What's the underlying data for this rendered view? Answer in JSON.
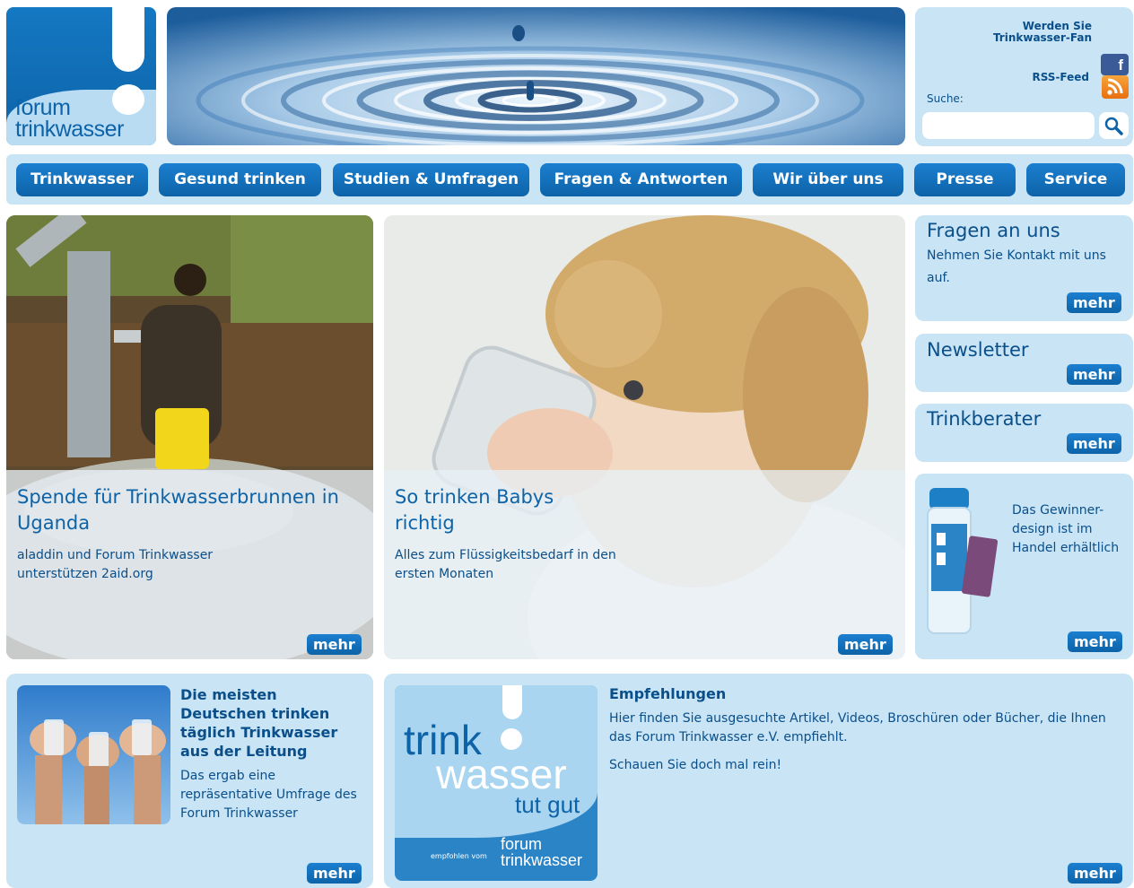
{
  "logo": {
    "line1": "forum",
    "line2": "trinkwasser"
  },
  "topright": {
    "fan_text": "Werden Sie Trinkwasser-Fan",
    "rss_label": "RSS-Feed",
    "search_label": "Suche:",
    "search_value": ""
  },
  "nav": [
    {
      "label": "Trinkwasser"
    },
    {
      "label": "Gesund trinken"
    },
    {
      "label": "Studien & Umfragen"
    },
    {
      "label": "Fragen & Antworten"
    },
    {
      "label": "Wir über uns"
    },
    {
      "label": "Presse"
    },
    {
      "label": "Service"
    }
  ],
  "features": [
    {
      "title": "Spende für Trinkwasserbrunnen in Uganda",
      "subtitle": "aladdin und Forum Trinkwasser unterstützen 2aid.org",
      "more": "mehr"
    },
    {
      "title": "So trinken Babys richtig",
      "subtitle": "Alles zum Flüssigkeitsbedarf in den ersten Monaten",
      "more": "mehr"
    }
  ],
  "sidebar": {
    "fragen": {
      "title": "Fragen an uns",
      "text": "Nehmen Sie Kontakt mit uns auf.",
      "more": "mehr"
    },
    "newsletter": {
      "title": "Newsletter",
      "more": "mehr"
    },
    "trinkberater": {
      "title": "Trinkberater",
      "more": "mehr"
    },
    "promo": {
      "text": "Das Gewinner-design ist im Handel erhältlich",
      "more": "mehr"
    }
  },
  "bottom": {
    "survey": {
      "title": "Die meisten Deutschen trinken täglich Trinkwasser aus der Leitung",
      "text": "Das ergab eine repräsentative Umfrage des Forum Trinkwasser",
      "more": "mehr"
    },
    "badge": {
      "line1": "trink",
      "line2": "wasser",
      "line3": "tut gut",
      "small": "empfohlen vom",
      "brand1": "forum",
      "brand2": "trinkwasser"
    },
    "empfehlungen": {
      "title": "Empfehlungen",
      "text": "Hier finden Sie ausgesuchte Artikel, Videos, Broschüren oder Bücher, die Ihnen das Forum Trinkwasser e.V. empfiehlt.",
      "text2": "Schauen Sie doch mal rein!",
      "more": "mehr"
    }
  },
  "colors": {
    "brand_blue": "#0d63a8",
    "panel_bg": "#c8e4f5"
  }
}
